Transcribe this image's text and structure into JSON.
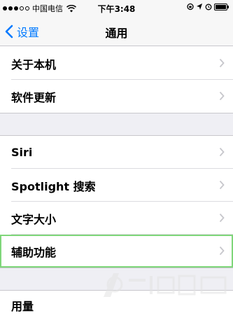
{
  "status_bar": {
    "carrier": "中国电信",
    "time": "下午3:48"
  },
  "nav": {
    "back_label": "设置",
    "title": "通用"
  },
  "group1": [
    {
      "label": "关于本机"
    },
    {
      "label": "软件更新"
    }
  ],
  "group2": [
    {
      "label": "Siri"
    },
    {
      "label": "Spotlight 搜索"
    },
    {
      "label": "文字大小"
    },
    {
      "label": "辅助功能"
    }
  ],
  "group3": [
    {
      "label": "用量"
    }
  ],
  "colors": {
    "accent": "#007aff",
    "highlight_border": "#7fd67a",
    "group_background": "#efeff4"
  }
}
